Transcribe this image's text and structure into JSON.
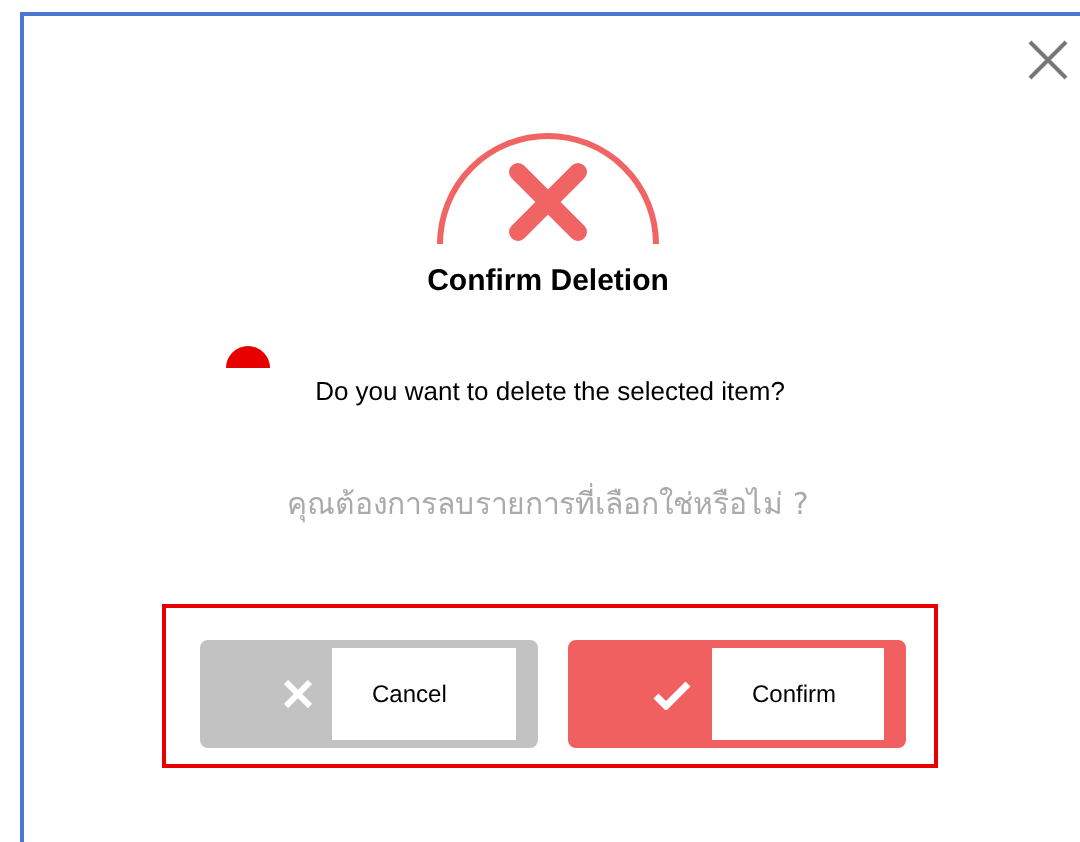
{
  "dialog": {
    "title": "Confirm Deletion",
    "message": "Do you want to delete the selected item?",
    "message_thai": "คุณต้องการลบรายการที่เลือกใช่หรือไม่ ?",
    "buttons": [
      {
        "label": "Cancel",
        "kind": "cancel"
      },
      {
        "label": "Confirm",
        "kind": "confirm"
      }
    ]
  }
}
